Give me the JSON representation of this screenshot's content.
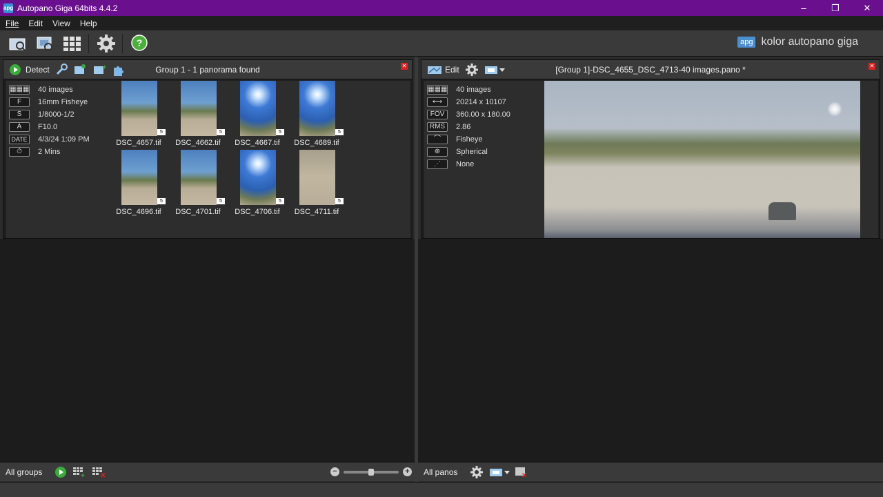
{
  "window": {
    "title": "Autopano Giga 64bits 4.4.2",
    "app_icon_text": "apg",
    "minimize": "–",
    "restore": "❐",
    "close": "✕"
  },
  "menu": [
    "File",
    "Edit",
    "View",
    "Help"
  ],
  "brand": {
    "logo": "apg",
    "text": "kolor autopano giga"
  },
  "groups_panel": {
    "detect_label": "Detect",
    "title": "Group 1 - 1 panorama found",
    "info": [
      {
        "badge": "▦▦▦",
        "value": "40 images"
      },
      {
        "badge": "F",
        "value": "16mm Fisheye"
      },
      {
        "badge": "S",
        "value": "1/8000-1/2"
      },
      {
        "badge": "A",
        "value": "F10.0"
      },
      {
        "badge": "DATE",
        "value": "4/3/24 1:09 PM"
      },
      {
        "badge": "⏱",
        "value": "2 Mins"
      }
    ],
    "thumbnails": [
      {
        "name": "DSC_4657.tif",
        "badge": "5"
      },
      {
        "name": "DSC_4662.tif",
        "badge": "5"
      },
      {
        "name": "DSC_4667.tif",
        "badge": "5"
      },
      {
        "name": "DSC_4689.tif",
        "badge": "5"
      },
      {
        "name": "DSC_4696.tif",
        "badge": "5"
      },
      {
        "name": "DSC_4701.tif",
        "badge": "5"
      },
      {
        "name": "DSC_4706.tif",
        "badge": "5"
      },
      {
        "name": "DSC_4711.tif",
        "badge": "5"
      }
    ],
    "bottom_label": "All groups"
  },
  "pano_panel": {
    "edit_label": "Edit",
    "title": "[Group 1]-DSC_4655_DSC_4713-40 images.pano *",
    "info": [
      {
        "badge": "▦▦▦",
        "value": "40 images"
      },
      {
        "badge": "⟷",
        "value": "20214 x 10107"
      },
      {
        "badge": "FOV",
        "value": "360.00 x 180.00"
      },
      {
        "badge": "RMS",
        "value": "2.86"
      },
      {
        "badge": "⌒",
        "value": "Fisheye"
      },
      {
        "badge": "⊕",
        "value": "Spherical"
      },
      {
        "badge": "⋰",
        "value": "None"
      }
    ],
    "bottom_label": "All panos"
  },
  "colors": {
    "titlebar": "#6a0f8e",
    "panel_bg": "#1e1e1e",
    "header_bg": "#3a3a3a",
    "close_red": "#dd2222"
  }
}
